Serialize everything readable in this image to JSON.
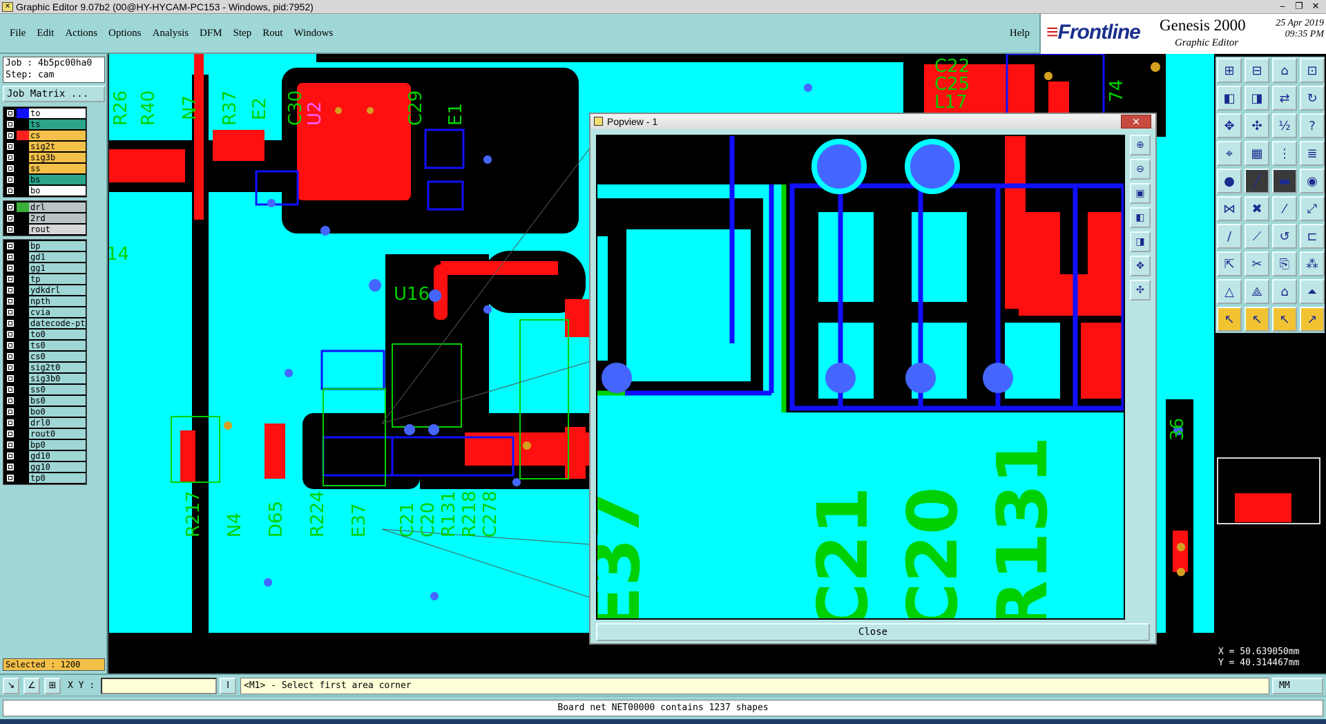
{
  "window": {
    "title": "Graphic Editor 9.07b2 (00@HY-HYCAM-PC153 - Windows, pid:7952)",
    "controls": [
      "–",
      "❐",
      "✕"
    ]
  },
  "menu": {
    "items": [
      "File",
      "Edit",
      "Actions",
      "Options",
      "Analysis",
      "DFM",
      "Step",
      "Rout",
      "Windows"
    ],
    "help": "Help"
  },
  "brand": {
    "frontline": "Frontline",
    "product": "Genesis 2000",
    "subtitle": "Graphic Editor",
    "date": "25 Apr 2019",
    "time": "09:35 PM"
  },
  "job": {
    "job_line": "Job : 4b5pc00ha0",
    "step_line": "Step: cam",
    "matrix_button": "Job Matrix ..."
  },
  "layers": {
    "group1": [
      {
        "name": "to",
        "color": "#ffffff",
        "swatch": "#1010ff"
      },
      {
        "name": "ts",
        "color": "#2aa58a",
        "swatch": "#000000"
      },
      {
        "name": "cs",
        "color": "#f3c14a",
        "swatch": "#ff2020"
      },
      {
        "name": "sig2t",
        "color": "#f3c14a",
        "swatch": "#000000"
      },
      {
        "name": "sig3b",
        "color": "#f3c14a",
        "swatch": "#000000"
      },
      {
        "name": "ss",
        "color": "#f3c14a",
        "swatch": "#000000"
      },
      {
        "name": "bs",
        "color": "#2aa58a",
        "swatch": "#000000"
      },
      {
        "name": "bo",
        "color": "#ffffff",
        "swatch": "#000000"
      }
    ],
    "group2": [
      {
        "name": "drl",
        "color": "#b9c4c4",
        "swatch": "#3ab03a"
      },
      {
        "name": "2rd",
        "color": "#b9c4c4",
        "swatch": "#000000"
      },
      {
        "name": "rout",
        "color": "#d8d8d8",
        "swatch": "#000000"
      }
    ],
    "group3": [
      {
        "name": "bp",
        "color": "#9fd6d6"
      },
      {
        "name": "gd1",
        "color": "#9fd6d6"
      },
      {
        "name": "gg1",
        "color": "#9fd6d6"
      },
      {
        "name": "tp",
        "color": "#9fd6d6"
      },
      {
        "name": "ydkdrl",
        "color": "#9fd6d6"
      },
      {
        "name": "npth",
        "color": "#9fd6d6"
      },
      {
        "name": "cvia",
        "color": "#9fd6d6"
      },
      {
        "name": "datecode-pt",
        "color": "#9fd6d6"
      },
      {
        "name": "to0",
        "color": "#9fd6d6"
      },
      {
        "name": "ts0",
        "color": "#9fd6d6"
      },
      {
        "name": "cs0",
        "color": "#9fd6d6"
      },
      {
        "name": "sig2t0",
        "color": "#9fd6d6"
      },
      {
        "name": "sig3b0",
        "color": "#9fd6d6"
      },
      {
        "name": "ss0",
        "color": "#9fd6d6"
      },
      {
        "name": "bs0",
        "color": "#9fd6d6"
      },
      {
        "name": "bo0",
        "color": "#9fd6d6"
      },
      {
        "name": "drl0",
        "color": "#9fd6d6"
      },
      {
        "name": "rout0",
        "color": "#9fd6d6"
      },
      {
        "name": "bp0",
        "color": "#9fd6d6"
      },
      {
        "name": "gd10",
        "color": "#9fd6d6"
      },
      {
        "name": "gg10",
        "color": "#9fd6d6"
      },
      {
        "name": "tp0",
        "color": "#9fd6d6"
      }
    ]
  },
  "selected": "Selected : 1200",
  "canvas_labels": {
    "top": [
      "R26",
      "R40",
      "N7",
      "R37",
      "E2",
      "C30",
      "U2",
      "C29",
      "E1",
      "C22",
      "C25",
      "L17"
    ],
    "bottom": [
      "R217",
      "N4",
      "D65",
      "R224",
      "E37",
      "C21",
      "C20",
      "R131",
      "R218",
      "C278"
    ],
    "misc": [
      "14",
      "U16",
      "74",
      "36"
    ]
  },
  "popview": {
    "title": "Popview - 1",
    "close_x": "✕",
    "close_button": "Close",
    "labels": [
      "C21",
      "C20",
      "R131",
      "E37"
    ]
  },
  "coords": {
    "x": "X = 50.639050mm",
    "y": "Y = 40.314467mm"
  },
  "command": {
    "xy_label": "X Y :",
    "xy_value": "",
    "prompt": "<M1> - Select first area corner",
    "units": "MM"
  },
  "status": "Board net NET00000 contains 1237 shapes",
  "colors": {
    "board": "#00ffff",
    "copper": "#ff1010",
    "blue_trace": "#1010ff",
    "silk": "#00d000",
    "pad": "#4466ff"
  }
}
